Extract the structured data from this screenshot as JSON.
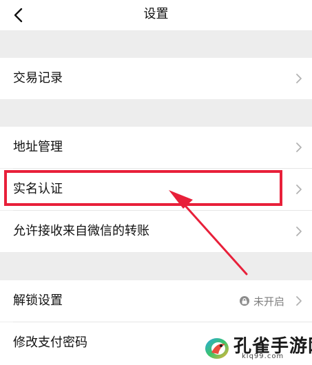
{
  "header": {
    "title": "设置",
    "back_icon": "chevron-left-icon"
  },
  "rows": [
    {
      "label": "交易记录"
    },
    {
      "label": "地址管理"
    },
    {
      "label": "实名认证"
    },
    {
      "label": "允许接收来自微信的转账"
    },
    {
      "label": "解锁设置",
      "status": "未开启",
      "status_icon": "lock-icon"
    },
    {
      "label": "修改支付密码"
    }
  ],
  "annotation": {
    "color": "#e8203a"
  },
  "watermark": {
    "title": "孔雀手游网",
    "url": "klq99.com"
  }
}
